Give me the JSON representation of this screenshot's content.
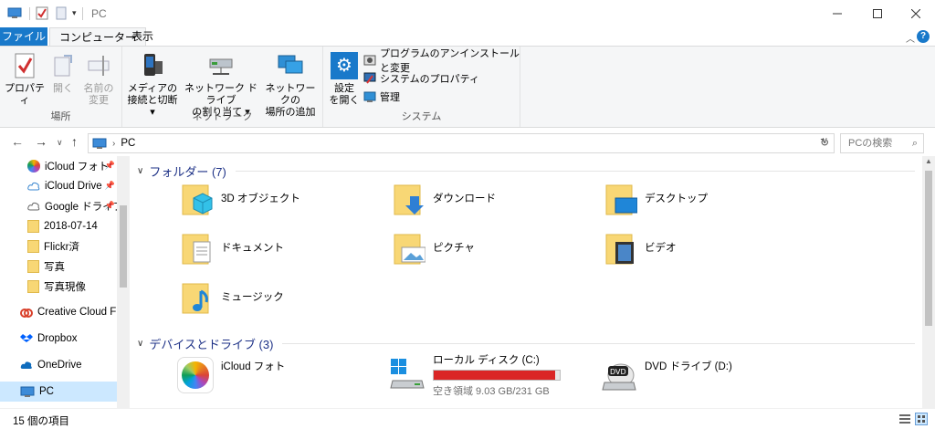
{
  "window": {
    "title": "PC"
  },
  "tabs": {
    "file": "ファイル",
    "computer": "コンピューター",
    "view": "表示"
  },
  "ribbon": {
    "location": {
      "label": "場所",
      "properties": "プロパティ",
      "open": "開く",
      "rename_line1": "名前の",
      "rename_line2": "変更"
    },
    "network": {
      "label": "ネットワーク",
      "media_line1": "メディアの",
      "media_line2": "接続と切断",
      "mapdrive_line1": "ネットワーク ドライブ",
      "mapdrive_line2": "の割り当て",
      "addloc_line1": "ネットワークの",
      "addloc_line2": "場所の追加"
    },
    "system": {
      "label": "システム",
      "settings_line1": "設定",
      "settings_line2": "を開く",
      "uninstall": "プログラムのアンインストールと変更",
      "sysprops": "システムのプロパティ",
      "manage": "管理"
    }
  },
  "address": {
    "path": "PC",
    "search_placeholder": "PCの検索"
  },
  "nav": {
    "items": [
      {
        "label": "iCloud フォト",
        "icon": "icloud-photos-icon",
        "pinned": true
      },
      {
        "label": "iCloud Drive",
        "icon": "icloud-drive-icon",
        "pinned": true
      },
      {
        "label": "Google ドライブ",
        "icon": "google-drive-icon",
        "pinned": true
      },
      {
        "label": "2018-07-14",
        "icon": "folder-icon"
      },
      {
        "label": "Flickr済",
        "icon": "folder-icon"
      },
      {
        "label": "写真",
        "icon": "folder-icon"
      },
      {
        "label": "写真現像",
        "icon": "folder-icon"
      },
      {
        "label": "Creative Cloud Files",
        "icon": "creative-cloud-icon"
      },
      {
        "label": "Dropbox",
        "icon": "dropbox-icon"
      },
      {
        "label": "OneDrive",
        "icon": "onedrive-icon"
      },
      {
        "label": "PC",
        "icon": "pc-icon"
      }
    ]
  },
  "content": {
    "folders_header": "フォルダー (7)",
    "folders": [
      {
        "name": "3D オブジェクト",
        "icon": "3d-objects-folder-icon"
      },
      {
        "name": "ダウンロード",
        "icon": "downloads-folder-icon"
      },
      {
        "name": "デスクトップ",
        "icon": "desktop-folder-icon"
      },
      {
        "name": "ドキュメント",
        "icon": "documents-folder-icon"
      },
      {
        "name": "ピクチャ",
        "icon": "pictures-folder-icon"
      },
      {
        "name": "ビデオ",
        "icon": "videos-folder-icon"
      },
      {
        "name": "ミュージック",
        "icon": "music-folder-icon"
      }
    ],
    "devices_header": "デバイスとドライブ (3)",
    "devices": {
      "icloud": {
        "name": "iCloud フォト"
      },
      "local": {
        "name": "ローカル ディスク (C:)",
        "free": "空き領域 9.03 GB/231 GB",
        "used_fraction": 0.961,
        "bar_color": "#da2626"
      },
      "dvd": {
        "name": "DVD ドライブ (D:)"
      }
    }
  },
  "status": {
    "count": "15 個の項目"
  },
  "colors": {
    "accent": "#1979ca",
    "header_text": "#1e3287",
    "selected": "#cce8ff"
  }
}
